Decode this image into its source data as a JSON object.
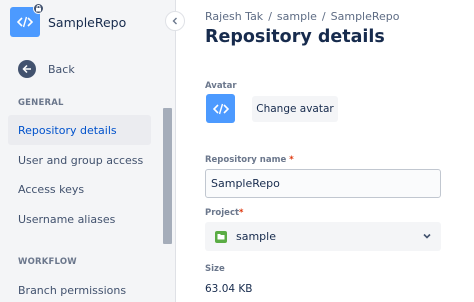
{
  "sidebar": {
    "repo_name": "SampleRepo",
    "repo_icon": "code-brackets-icon",
    "lock_icon": "lock-icon",
    "back_label": "Back",
    "sections": {
      "general": "GENERAL",
      "workflow": "WORKFLOW"
    },
    "items": [
      {
        "label": "Repository details",
        "active": true
      },
      {
        "label": "User and group access",
        "active": false
      },
      {
        "label": "Access keys",
        "active": false
      },
      {
        "label": "Username aliases",
        "active": false
      },
      {
        "label": "Branch permissions",
        "active": false
      }
    ]
  },
  "breadcrumb": [
    "Rajesh Tak",
    "sample",
    "SampleRepo"
  ],
  "page_title": "Repository details",
  "form": {
    "avatar_label": "Avatar",
    "change_avatar_label": "Change avatar",
    "repo_name_label": "Repository name",
    "repo_name_value": "SampleRepo",
    "project_label": "Project",
    "project_value": "sample",
    "size_label": "Size",
    "size_value": "63.04 KB",
    "required_mark": "*"
  },
  "colors": {
    "accent": "#0052cc",
    "avatar_blue": "#4c9aff",
    "project_green": "#5aac44",
    "required_red": "#de350b"
  }
}
